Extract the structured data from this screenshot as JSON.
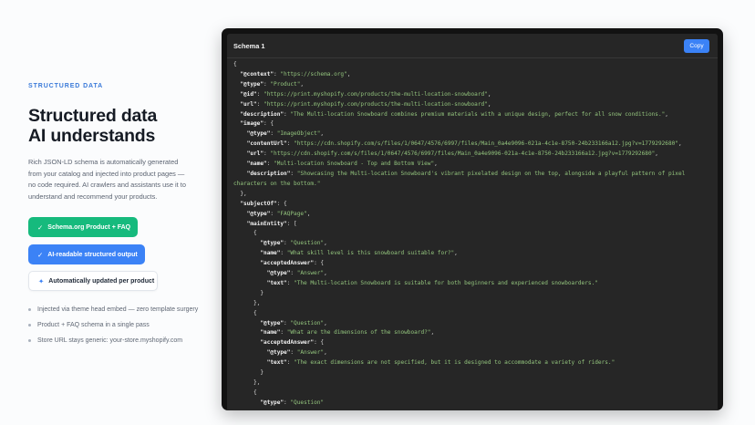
{
  "left": {
    "eyebrow": "STRUCTURED DATA",
    "headline_line1": "Structured data",
    "headline_line2": "AI understands",
    "description": "Rich JSON-LD schema is automatically generated from your catalog and injected into product pages — no code required. AI crawlers and assistants use it to understand and recommend your products.",
    "pills": [
      {
        "label": "Schema.org Product + FAQ",
        "icon": "check-icon"
      },
      {
        "label": "AI-readable structured output",
        "icon": "check-icon"
      },
      {
        "label": "Automatically updated per product",
        "icon": "sparkle-icon"
      }
    ],
    "bullets": [
      "Injected via theme head embed — zero template surgery",
      "Product + FAQ schema in a single pass",
      "Store URL stays generic: your-store.myshopify.com"
    ]
  },
  "panel": {
    "title": "Schema 1",
    "copy_label": "Copy"
  },
  "code_lines": [
    [
      [
        "p",
        "{"
      ]
    ],
    [
      [
        "p",
        "  "
      ],
      [
        "k",
        "\"@context\""
      ],
      [
        "p",
        ": "
      ],
      [
        "s",
        "\"https://schema.org\""
      ],
      [
        "p",
        ","
      ]
    ],
    [
      [
        "p",
        "  "
      ],
      [
        "k",
        "\"@type\""
      ],
      [
        "p",
        ": "
      ],
      [
        "s",
        "\"Product\""
      ],
      [
        "p",
        ","
      ]
    ],
    [
      [
        "p",
        "  "
      ],
      [
        "k",
        "\"@id\""
      ],
      [
        "p",
        ": "
      ],
      [
        "s",
        "\"https://print.myshopify.com/products/the-multi-location-snowboard\""
      ],
      [
        "p",
        ","
      ]
    ],
    [
      [
        "p",
        "  "
      ],
      [
        "k",
        "\"url\""
      ],
      [
        "p",
        ": "
      ],
      [
        "s",
        "\"https://print.myshopify.com/products/the-multi-location-snowboard\""
      ],
      [
        "p",
        ","
      ]
    ],
    [
      [
        "p",
        "  "
      ],
      [
        "k",
        "\"description\""
      ],
      [
        "p",
        ": "
      ],
      [
        "s",
        "\"The Multi-location Snowboard combines premium materials with a unique design, perfect for all snow conditions.\""
      ],
      [
        "p",
        ","
      ]
    ],
    [
      [
        "p",
        "  "
      ],
      [
        "k",
        "\"image\""
      ],
      [
        "p",
        ": {"
      ]
    ],
    [
      [
        "p",
        "    "
      ],
      [
        "k",
        "\"@type\""
      ],
      [
        "p",
        ": "
      ],
      [
        "s",
        "\"ImageObject\""
      ],
      [
        "p",
        ","
      ]
    ],
    [
      [
        "p",
        "    "
      ],
      [
        "k",
        "\"contentUrl\""
      ],
      [
        "p",
        ": "
      ],
      [
        "s",
        "\"https://cdn.shopify.com/s/files/1/0647/4576/6997/files/Main_0a4e9096-021a-4c1e-8750-24b233166a12.jpg?v=1779292680\""
      ],
      [
        "p",
        ","
      ]
    ],
    [
      [
        "p",
        "    "
      ],
      [
        "k",
        "\"url\""
      ],
      [
        "p",
        ": "
      ],
      [
        "s",
        "\"https://cdn.shopify.com/s/files/1/0647/4576/6997/files/Main_0a4e9096-021a-4c1e-8750-24b233166a12.jpg?v=1779292680\""
      ],
      [
        "p",
        ","
      ]
    ],
    [
      [
        "p",
        "    "
      ],
      [
        "k",
        "\"name\""
      ],
      [
        "p",
        ": "
      ],
      [
        "s",
        "\"Multi-location Snowboard - Top and Bottom View\""
      ],
      [
        "p",
        ","
      ]
    ],
    [
      [
        "p",
        "    "
      ],
      [
        "k",
        "\"description\""
      ],
      [
        "p",
        ": "
      ],
      [
        "s",
        "\"Showcasing the Multi-location Snowboard's vibrant pixelated design on the top, alongside a playful pattern of pixel"
      ]
    ],
    [
      [
        "s",
        "characters on the bottom.\""
      ]
    ],
    [
      [
        "p",
        "  },"
      ]
    ],
    [
      [
        "p",
        "  "
      ],
      [
        "k",
        "\"subjectOf\""
      ],
      [
        "p",
        ": {"
      ]
    ],
    [
      [
        "p",
        "    "
      ],
      [
        "k",
        "\"@type\""
      ],
      [
        "p",
        ": "
      ],
      [
        "s",
        "\"FAQPage\""
      ],
      [
        "p",
        ","
      ]
    ],
    [
      [
        "p",
        "    "
      ],
      [
        "k",
        "\"mainEntity\""
      ],
      [
        "p",
        ": ["
      ]
    ],
    [
      [
        "p",
        "      {"
      ]
    ],
    [
      [
        "p",
        "        "
      ],
      [
        "k",
        "\"@type\""
      ],
      [
        "p",
        ": "
      ],
      [
        "s",
        "\"Question\""
      ],
      [
        "p",
        ","
      ]
    ],
    [
      [
        "p",
        "        "
      ],
      [
        "k",
        "\"name\""
      ],
      [
        "p",
        ": "
      ],
      [
        "s",
        "\"What skill level is this snowboard suitable for?\""
      ],
      [
        "p",
        ","
      ]
    ],
    [
      [
        "p",
        "        "
      ],
      [
        "k",
        "\"acceptedAnswer\""
      ],
      [
        "p",
        ": {"
      ]
    ],
    [
      [
        "p",
        "          "
      ],
      [
        "k",
        "\"@type\""
      ],
      [
        "p",
        ": "
      ],
      [
        "s",
        "\"Answer\""
      ],
      [
        "p",
        ","
      ]
    ],
    [
      [
        "p",
        "          "
      ],
      [
        "k",
        "\"text\""
      ],
      [
        "p",
        ": "
      ],
      [
        "s",
        "\"The Multi-location Snowboard is suitable for both beginners and experienced snowboarders.\""
      ]
    ],
    [
      [
        "p",
        "        }"
      ]
    ],
    [
      [
        "p",
        "      },"
      ]
    ],
    [
      [
        "p",
        "      {"
      ]
    ],
    [
      [
        "p",
        "        "
      ],
      [
        "k",
        "\"@type\""
      ],
      [
        "p",
        ": "
      ],
      [
        "s",
        "\"Question\""
      ],
      [
        "p",
        ","
      ]
    ],
    [
      [
        "p",
        "        "
      ],
      [
        "k",
        "\"name\""
      ],
      [
        "p",
        ": "
      ],
      [
        "s",
        "\"What are the dimensions of the snowboard?\""
      ],
      [
        "p",
        ","
      ]
    ],
    [
      [
        "p",
        "        "
      ],
      [
        "k",
        "\"acceptedAnswer\""
      ],
      [
        "p",
        ": {"
      ]
    ],
    [
      [
        "p",
        "          "
      ],
      [
        "k",
        "\"@type\""
      ],
      [
        "p",
        ": "
      ],
      [
        "s",
        "\"Answer\""
      ],
      [
        "p",
        ","
      ]
    ],
    [
      [
        "p",
        "          "
      ],
      [
        "k",
        "\"text\""
      ],
      [
        "p",
        ": "
      ],
      [
        "s",
        "\"The exact dimensions are not specified, but it is designed to accommodate a variety of riders.\""
      ]
    ],
    [
      [
        "p",
        "        }"
      ]
    ],
    [
      [
        "p",
        "      },"
      ]
    ],
    [
      [
        "p",
        "      {"
      ]
    ],
    [
      [
        "p",
        "        "
      ],
      [
        "k",
        "\"@type\""
      ],
      [
        "p",
        ": "
      ],
      [
        "s",
        "\"Question\""
      ]
    ]
  ],
  "colors": {
    "accent": "#3b82f6",
    "success": "#16ba7d",
    "eyebrow": "#3a7ad9",
    "code_key": "#f0f0f0",
    "code_string": "#93c47d",
    "panel_bg": "#262626"
  }
}
